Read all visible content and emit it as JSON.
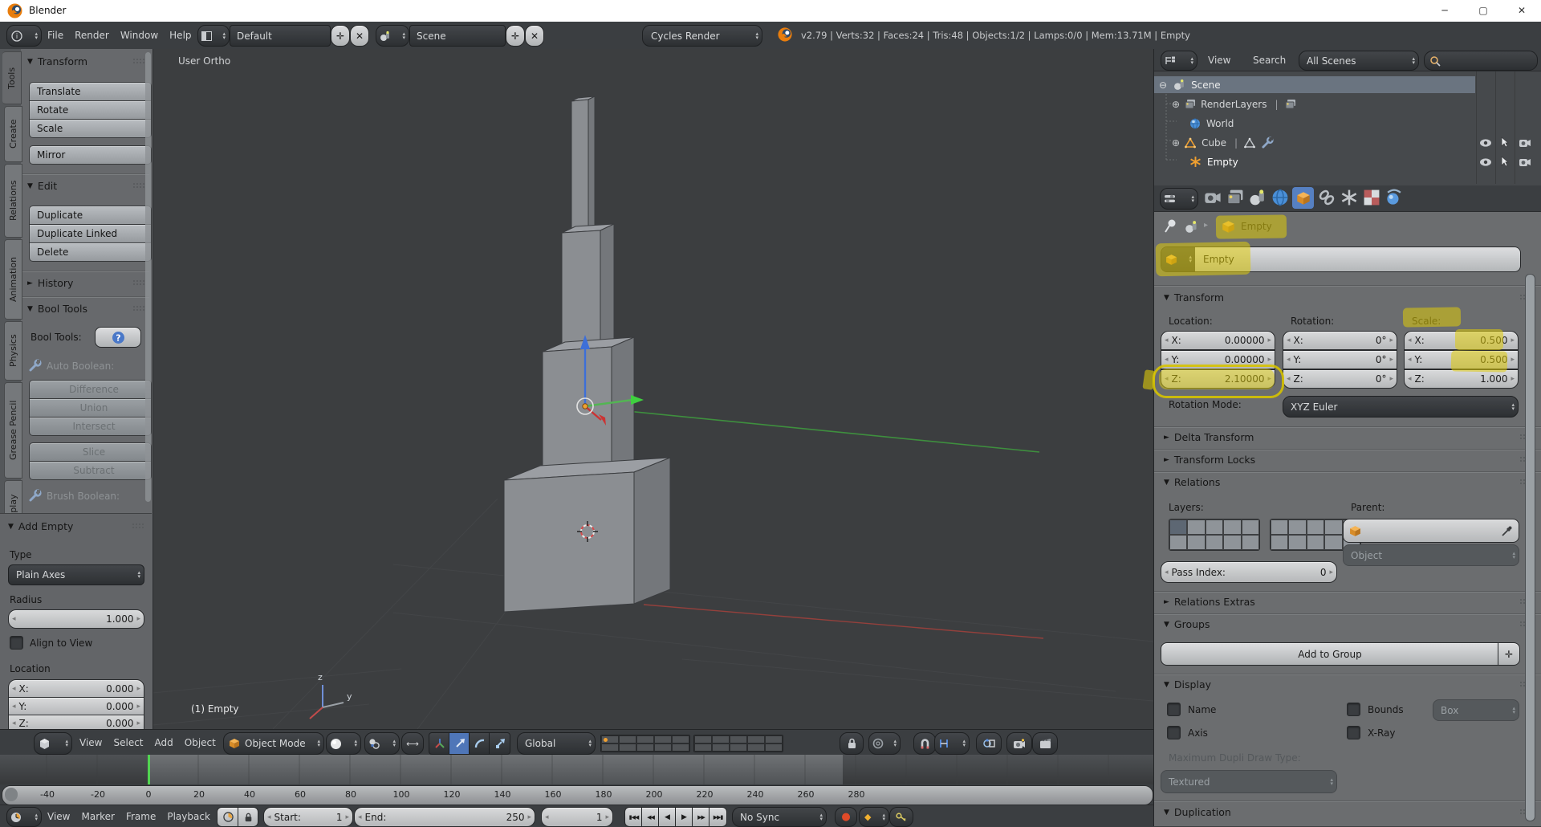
{
  "icons": {
    "tri_down": "▼",
    "tri_right": "►",
    "chip_up": "▴",
    "chip_dn": "▾",
    "arr_l": "◂",
    "arr_r": "▸",
    "plus": "✛",
    "close": "✕",
    "minimize": "─",
    "maximize": "▢",
    "circle_minus": "⊖",
    "circle_plus": "⊕",
    "pipe": "|",
    "help": "?",
    "crumb": "▸",
    "record": "●",
    "diamond": "◆",
    "arrows_lr": "⟷"
  },
  "window": {
    "title": "Blender"
  },
  "infobar": {
    "menus": [
      "File",
      "Render",
      "Window",
      "Help"
    ],
    "layout": "Default",
    "scene": "Scene",
    "engine": "Cycles Render",
    "stats": "v2.79 | Verts:32 | Faces:24 | Tris:48 | Objects:1/2 | Lamps:0/0 | Mem:13.71M | Empty"
  },
  "toolshelf": {
    "tabs": [
      "Tools",
      "Create",
      "Relations",
      "Animation",
      "Physics",
      "Grease Pencil",
      "Display"
    ],
    "transform": {
      "title": "Transform",
      "translate": "Translate",
      "rotate": "Rotate",
      "scale": "Scale",
      "mirror": "Mirror"
    },
    "edit": {
      "title": "Edit",
      "duplicate": "Duplicate",
      "duplicate_linked": "Duplicate Linked",
      "delete": "Delete"
    },
    "history": {
      "title": "History"
    },
    "bool": {
      "title": "Bool Tools",
      "label": "Bool Tools:",
      "auto_label": "Auto Boolean:",
      "difference": "Difference",
      "union": "Union",
      "intersect": "Intersect",
      "slice": "Slice",
      "subtract": "Subtract",
      "brush_label": "Brush Boolean:"
    },
    "add_empty": {
      "title": "Add Empty",
      "type_label": "Type",
      "type_value": "Plain Axes",
      "radius_label": "Radius",
      "radius_value": "1.000",
      "align": "Align to View",
      "location_label": "Location",
      "x_label": "X:",
      "x_value": "0.000",
      "y_label": "Y:",
      "y_value": "0.000",
      "z_label": "Z:",
      "z_value": "0.000"
    }
  },
  "viewport": {
    "view_label": "User Ortho",
    "status_label": "(1) Empty",
    "menus": [
      "View",
      "Select",
      "Add",
      "Object"
    ],
    "mode": "Object Mode",
    "orientation": "Global",
    "axis_z": "z",
    "axis_y": "y"
  },
  "timeline": {
    "menus": [
      "View",
      "Marker",
      "Frame",
      "Playback"
    ],
    "start_label": "Start:",
    "start_value": "1",
    "end_label": "End:",
    "end_value": "250",
    "current_frame": "1",
    "sync": "No Sync",
    "playback": [
      "▮◀◀",
      "◀◀",
      "◀",
      "▶",
      "▶▶",
      "▶▶▮"
    ],
    "ticks": [
      "-40",
      "-20",
      "0",
      "20",
      "40",
      "60",
      "80",
      "100",
      "120",
      "140",
      "160",
      "180",
      "200",
      "220",
      "240",
      "260",
      "280"
    ]
  },
  "outliner": {
    "menus": [
      "View",
      "Search"
    ],
    "scope": "All Scenes",
    "scene": "Scene",
    "renderlayers": "RenderLayers",
    "world": "World",
    "cube": "Cube",
    "empty": "Empty"
  },
  "properties": {
    "breadcrumb": "Empty",
    "name_value": "Empty",
    "transform": {
      "title": "Transform",
      "location_label": "Location:",
      "rotation_label": "Rotation:",
      "scale_label": "Scale:",
      "loc": {
        "x_label": "X:",
        "x": "0.00000",
        "y_label": "Y:",
        "y": "0.00000",
        "z_label": "Z:",
        "z": "2.10000"
      },
      "rot": {
        "x_label": "X:",
        "x": "0°",
        "y_label": "Y:",
        "y": "0°",
        "z_label": "Z:",
        "z": "0°"
      },
      "scl": {
        "x_label": "X:",
        "x": "0.500",
        "y_label": "Y:",
        "y": "0.500",
        "z_label": "Z:",
        "z": "1.000"
      },
      "rotation_mode_label": "Rotation Mode:",
      "rotation_mode": "XYZ Euler"
    },
    "delta": "Delta Transform",
    "locks": "Transform Locks",
    "relations": {
      "title": "Relations",
      "layers_label": "Layers:",
      "parent_label": "Parent:",
      "object": "Object",
      "pass_label": "Pass Index:",
      "pass_value": "0"
    },
    "relations_extras": "Relations Extras",
    "groups": {
      "title": "Groups",
      "add": "Add to Group"
    },
    "display": {
      "title": "Display",
      "name": "Name",
      "axis": "Axis",
      "bounds": "Bounds",
      "box": "Box",
      "xray": "X-Ray",
      "dupli_label": "Maximum Dupli Draw Type:",
      "textured": "Textured"
    },
    "duplication": "Duplication"
  },
  "colors": {
    "accent_blue": "#5680c2",
    "highlight_yellow": "#decb0a",
    "selection_orange": "#f0a030"
  }
}
